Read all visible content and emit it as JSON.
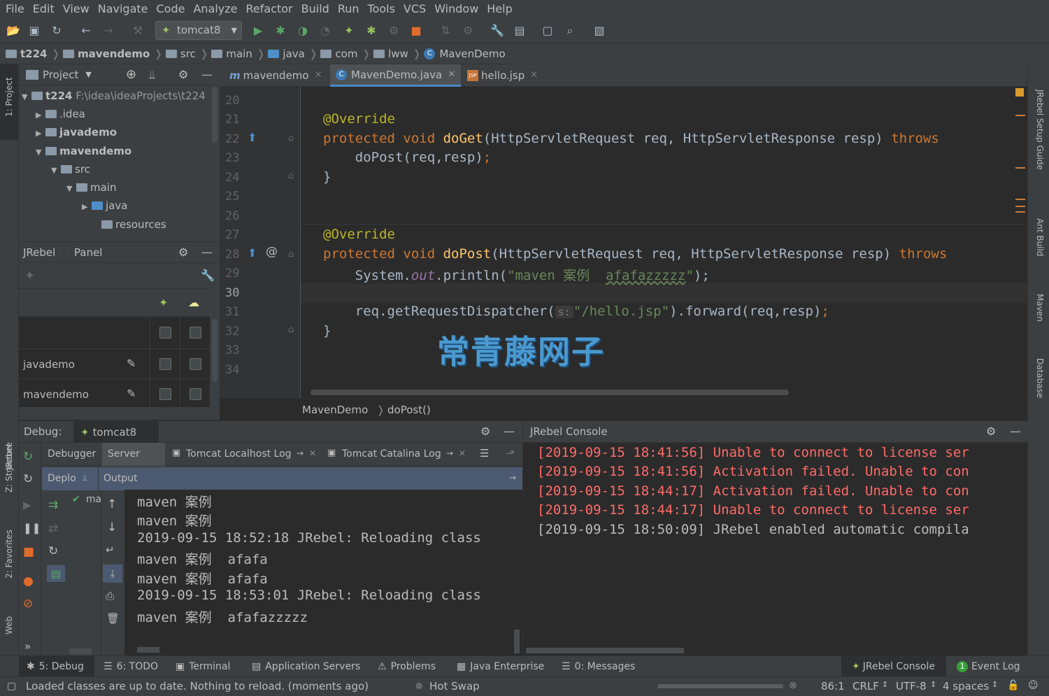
{
  "menu": [
    "File",
    "Edit",
    "View",
    "Navigate",
    "Code",
    "Analyze",
    "Refactor",
    "Build",
    "Run",
    "Tools",
    "VCS",
    "Window",
    "Help"
  ],
  "toolbar": {
    "run_config": "tomcat8"
  },
  "breadcrumb": [
    "t224",
    "mavendemo",
    "src",
    "main",
    "java",
    "com",
    "lww",
    "MavenDemo"
  ],
  "left_stripe": {
    "project": "1: Project",
    "jrebel": "JRebel",
    "structure": "Z: Structure",
    "favorites": "2: Favorites",
    "web": "Web"
  },
  "right_stripe": {
    "setup": "JRebel Setup Guide",
    "ant": "Ant Build",
    "maven": "Maven",
    "database": "Database"
  },
  "project": {
    "title": "Project",
    "root_name": "t224",
    "root_path": "F:\\idea\\ideaProjects\\t224",
    "items": [
      ".idea",
      "javademo",
      "mavendemo",
      "src",
      "main",
      "java",
      "resources"
    ]
  },
  "jrebel_panel": {
    "tab1": "JRebel",
    "tab2": "Panel",
    "rows": [
      "javademo",
      "mavendemo"
    ]
  },
  "editor": {
    "tabs": [
      "mavendemo",
      "MavenDemo.java",
      "hello.jsp"
    ],
    "line_numbers": [
      "20",
      "21",
      "22",
      "23",
      "24",
      "25",
      "26",
      "27",
      "28",
      "29",
      "30",
      "31",
      "32",
      "33",
      "34"
    ],
    "lines": {
      "l21_annotation": "@Override",
      "l22_mod": "protected void ",
      "l22_fn": "doGet",
      "l22_args": "(HttpServletRequest req, HttpServletResponse resp) ",
      "l22_throws": "throws",
      "l23_call": "    doPost(req,resp)",
      "l23_semi": ";",
      "l24_close": "}",
      "l27_annotation": "@Override",
      "l28_mod": "protected void ",
      "l28_fn": "doPost",
      "l28_args": "(HttpServletRequest req, HttpServletResponse resp) ",
      "l28_throws": "throws",
      "l29_pre": "    System.",
      "l29_out": "out",
      "l29_mid": ".println(",
      "l29_str1": "\"maven 案例  ",
      "l29_str2": "afafazzzzz",
      "l29_str3": "\"",
      "l29_end": ");",
      "l31_pre": "    req.getRequestDispatcher(",
      "l31_hint": "s:",
      "l31_str": "\"/hello.jsp\"",
      "l31_end": ").forward(req,resp)",
      "l31_semi": ";",
      "l32_close": "}"
    },
    "watermark": "常青藤网子",
    "crumb_class": "MavenDemo",
    "crumb_method": "doPost()"
  },
  "debug": {
    "title": "Debug:",
    "session": "tomcat8",
    "tabs": [
      "Debugger",
      "Server",
      "Tomcat Localhost Log",
      "Tomcat Catalina Log"
    ],
    "deploy_label": "Deplo",
    "output_label": "Output",
    "deploy_item": "ma",
    "output_lines": [
      "maven 案例",
      "maven 案例",
      "2019-09-15 18:52:18 JRebel: Reloading class",
      "maven 案例  afafa",
      "maven 案例  afafa",
      "2019-09-15 18:53:01 JRebel: Reloading class",
      "maven 案例  afafazzzzz"
    ]
  },
  "jrebel_console": {
    "title": "JRebel Console",
    "lines": [
      {
        "text": "[2019-09-15 18:41:56] Unable to connect to license ser",
        "color": "#ff6b68"
      },
      {
        "text": "[2019-09-15 18:41:56] Activation failed. Unable to con",
        "color": "#ff6b68"
      },
      {
        "text": "[2019-09-15 18:44:17] Activation failed. Unable to con",
        "color": "#ff6b68"
      },
      {
        "text": "[2019-09-15 18:44:17] Unable to connect to license ser",
        "color": "#ff6b68"
      },
      {
        "text": "[2019-09-15 18:50:09] JRebel enabled automatic compila",
        "color": "#bbbbbb"
      }
    ]
  },
  "bottom_tabs": {
    "debug": "5: Debug",
    "todo": "6: TODO",
    "terminal": "Terminal",
    "app_servers": "Application Servers",
    "problems": "Problems",
    "java_enterprise": "Java Enterprise",
    "messages": "0: Messages",
    "jrebel_console": "JRebel Console",
    "event_log": "Event Log",
    "event_count": "1"
  },
  "status": {
    "message": "Loaded classes are up to date. Nothing to reload. (moments ago)",
    "hot_swap": "Hot Swap",
    "position": "86:1",
    "line_sep": "CRLF",
    "encoding": "UTF-8",
    "indent": "4 spaces"
  }
}
